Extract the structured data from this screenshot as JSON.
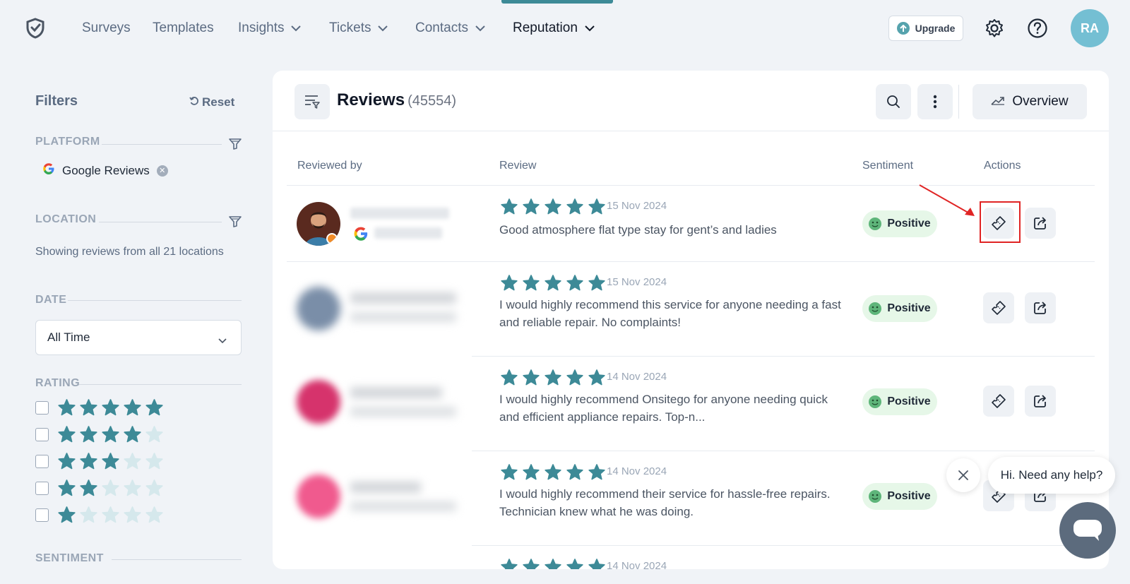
{
  "nav": {
    "items": [
      {
        "label": "Surveys",
        "has_menu": false
      },
      {
        "label": "Templates",
        "has_menu": false
      },
      {
        "label": "Insights",
        "has_menu": true
      },
      {
        "label": "Tickets",
        "has_menu": true
      },
      {
        "label": "Contacts",
        "has_menu": true
      },
      {
        "label": "Reputation",
        "has_menu": true,
        "active": true
      }
    ],
    "upgrade_label": "Upgrade",
    "avatar_initials": "RA",
    "accent_color": "#3d8a97"
  },
  "filters": {
    "title": "Filters",
    "reset_label": "Reset",
    "platform": {
      "label": "PLATFORM",
      "selected": "Google Reviews"
    },
    "location": {
      "label": "LOCATION",
      "text": "Showing reviews from all 21 locations"
    },
    "date": {
      "label": "DATE",
      "selected": "All Time"
    },
    "rating": {
      "label": "RATING",
      "options": [
        5,
        4,
        3,
        2,
        1
      ]
    },
    "sentiment": {
      "label": "SENTIMENT"
    }
  },
  "reviews": {
    "title": "Reviews",
    "count": "(45554)",
    "overview_label": "Overview",
    "columns": {
      "reviewed_by": "Reviewed by",
      "review": "Review",
      "sentiment": "Sentiment",
      "actions": "Actions"
    },
    "rows": [
      {
        "rating": 5,
        "date": "15 Nov 2024",
        "text": "Good atmosphere flat type stay for gent’s and ladies",
        "sentiment": "Positive"
      },
      {
        "rating": 5,
        "date": "15 Nov 2024",
        "text": "I would highly recommend this service for anyone needing a fast and reliable repair. No complaints!",
        "sentiment": "Positive"
      },
      {
        "rating": 5,
        "date": "14 Nov 2024",
        "text": "I would highly recommend Onsitego for anyone needing quick and efficient appliance repairs. Top-n...",
        "sentiment": "Positive"
      },
      {
        "rating": 5,
        "date": "14 Nov 2024",
        "text": "I would highly recommend their service for hassle-free repairs. Technician knew what he was doing.",
        "sentiment": "Positive"
      },
      {
        "rating": 5,
        "date": "14 Nov 2024",
        "text": "",
        "sentiment": ""
      }
    ]
  },
  "chat": {
    "greeting": "Hi. Need any help?"
  },
  "colors": {
    "star": "#3d8a97",
    "star_empty": "#d5e8ec",
    "positive_bg": "#e6f7e8",
    "highlight": "#e02424"
  }
}
